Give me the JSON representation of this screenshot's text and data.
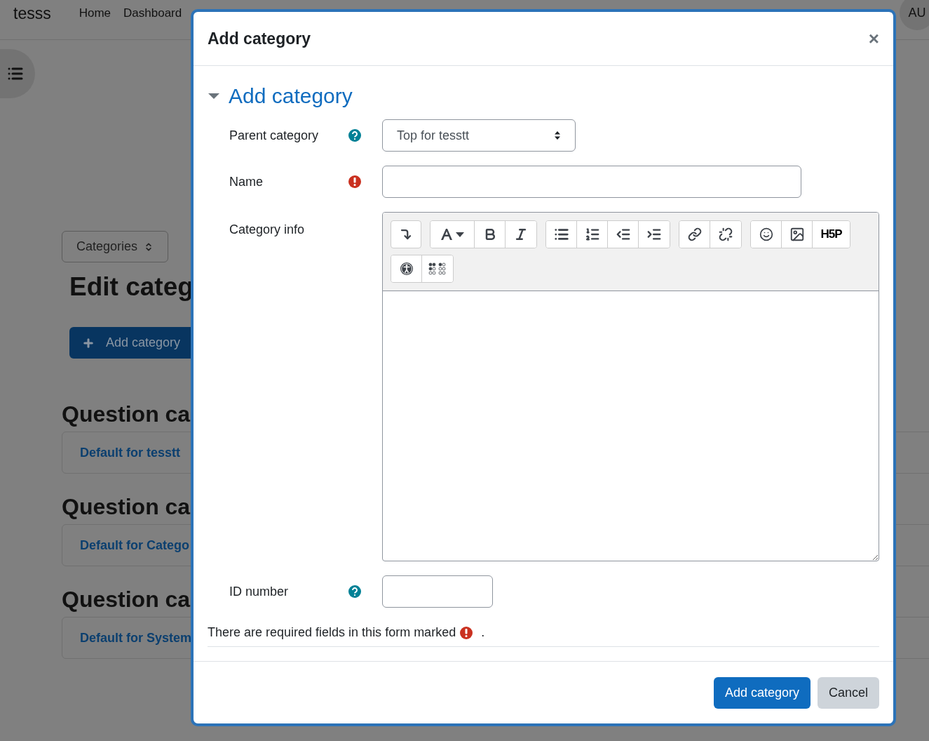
{
  "navbar": {
    "brand": "tesss",
    "links": [
      "Home",
      "Dashboard"
    ],
    "avatar": "AU"
  },
  "page": {
    "categories_select": "Categories",
    "title": "Edit categ",
    "add_button": "Add category",
    "sections": [
      {
        "heading": "Question ca",
        "item": "Default for tesstt"
      },
      {
        "heading": "Question ca",
        "item": "Default for Catego"
      },
      {
        "heading": "Question ca",
        "item": "Default for System"
      }
    ]
  },
  "dialog": {
    "title": "Add category",
    "close": "×",
    "section": {
      "title": "Add category",
      "expanded": true
    },
    "fields": [
      {
        "kind": "select",
        "label": "Parent category",
        "help": true,
        "value": "Top for tesstt"
      },
      {
        "kind": "text",
        "label": "Name",
        "required": true
      },
      {
        "kind": "editor",
        "label": "Category info",
        "h5p_label": "H5P"
      },
      {
        "kind": "short_text",
        "label": "ID number",
        "help": true
      }
    ],
    "required_note": "There are required fields in this form marked",
    "note_end": ".",
    "buttons": [
      {
        "label": "Add category",
        "kind": "primary"
      },
      {
        "label": "Cancel",
        "kind": "secondary"
      }
    ]
  }
}
